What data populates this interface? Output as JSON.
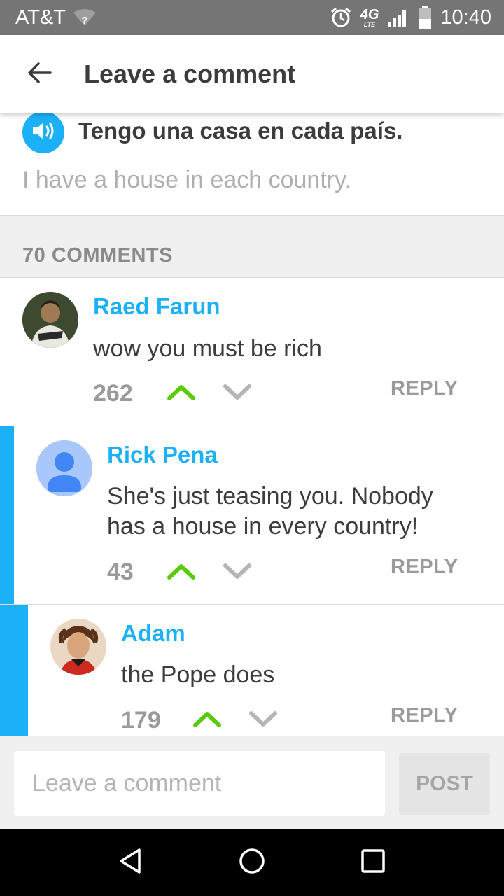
{
  "status_bar": {
    "carrier": "AT&T",
    "network": "4G",
    "network_sub": "LTE",
    "time": "10:40",
    "icons": [
      "wifi-question-icon",
      "alarm-icon",
      "signal-icon",
      "battery-icon"
    ]
  },
  "app_bar": {
    "title": "Leave a comment",
    "back_icon": "arrow-left-icon"
  },
  "sentence": {
    "text": "Tengo una casa en cada país.",
    "translation": "I have a house in each country.",
    "speaker_icon": "speaker-icon"
  },
  "comments_header": {
    "count_label": "70 COMMENTS"
  },
  "comments": [
    {
      "author": "Raed Farun",
      "text": "wow you must be rich",
      "votes": "262",
      "reply_label": "REPLY",
      "upvoted": true
    },
    {
      "author": "Rick Pena",
      "text": "She's just teasing you. Nobody has a house in every country!",
      "votes": "43",
      "reply_label": "REPLY",
      "upvoted": true
    },
    {
      "author": "Adam",
      "text": "the Pope does",
      "votes": "179",
      "reply_label": "REPLY",
      "upvoted": true
    }
  ],
  "compose": {
    "placeholder": "Leave a comment",
    "post_label": "POST"
  },
  "nav_bar": {
    "icons": [
      "back-triangle-icon",
      "home-circle-icon",
      "recents-square-icon"
    ]
  },
  "colors": {
    "accent": "#1cb0f6",
    "upvote": "#58cc02",
    "status_bar": "#757575"
  }
}
